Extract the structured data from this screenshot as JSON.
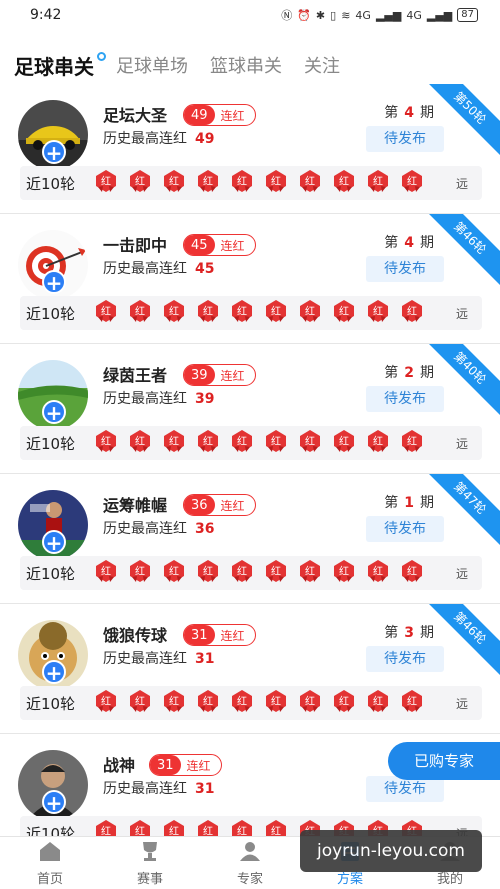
{
  "status": {
    "time": "9:42",
    "net_a": "4G",
    "net_b": "4G",
    "battery": "87"
  },
  "tabs": [
    {
      "label": "足球串关",
      "active": true
    },
    {
      "label": "足球单场",
      "active": false
    },
    {
      "label": "篮球串关",
      "active": false
    },
    {
      "label": "关注",
      "active": false
    }
  ],
  "card_labels": {
    "history": "历史最高连红",
    "streak": "连红",
    "period_prefix": "第",
    "period_suffix": "期",
    "recent": "近10轮",
    "far": "远",
    "marker": "红"
  },
  "experts": [
    {
      "name": "足坛大圣",
      "streak": "49",
      "history": "49",
      "period": "4",
      "status": "待发布",
      "ribbon": "第50轮",
      "avatar": "car"
    },
    {
      "name": "一击即中",
      "streak": "45",
      "history": "45",
      "period": "4",
      "status": "待发布",
      "ribbon": "第46轮",
      "avatar": "dart"
    },
    {
      "name": "绿茵王者",
      "streak": "39",
      "history": "39",
      "period": "2",
      "status": "待发布",
      "ribbon": "第40轮",
      "avatar": "field"
    },
    {
      "name": "运筹帷幄",
      "streak": "36",
      "history": "36",
      "period": "1",
      "status": "待发布",
      "ribbon": "第47轮",
      "avatar": "player"
    },
    {
      "name": "饿狼传球",
      "streak": "31",
      "history": "31",
      "period": "3",
      "status": "待发布",
      "ribbon": "第46轮",
      "avatar": "face"
    },
    {
      "name": "战神",
      "streak": "31",
      "history": "31",
      "period": "",
      "status": "待发布",
      "ribbon": "",
      "avatar": "man"
    }
  ],
  "fab": {
    "label": "已购专家"
  },
  "nav": [
    {
      "label": "首页",
      "icon": "home-icon",
      "active": false
    },
    {
      "label": "赛事",
      "icon": "trophy-icon",
      "active": false
    },
    {
      "label": "专家",
      "icon": "expert-icon",
      "active": false
    },
    {
      "label": "方案",
      "icon": "plan-icon",
      "active": true
    },
    {
      "label": "我的",
      "icon": "profile-icon",
      "active": false
    }
  ],
  "watermark": "joyrun-leyou.com",
  "colors": {
    "accent": "#1f88ea",
    "red": "#e33333",
    "ribbon": "#1e94f0"
  }
}
